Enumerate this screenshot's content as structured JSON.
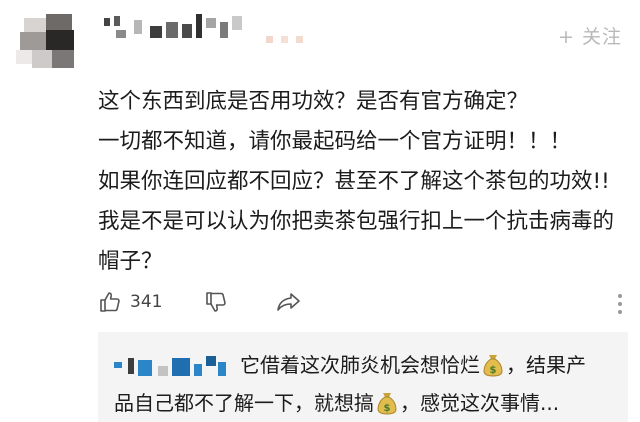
{
  "header": {
    "follow_label": "+ 关注"
  },
  "comment": {
    "lines": [
      "这个东西到底是否用功效？是否有官方确定？",
      "一切都不知道，请你最起码给一个官方证明！！！",
      "如果你连回应都不回应？甚至不了解这个茶包的功效!!",
      "我是不是可以认为你把卖茶包强行扣上一个抗击病毒的",
      "帽子？"
    ]
  },
  "actions": {
    "like_icon": "thumbs-up-icon",
    "like_count": "341",
    "dislike_icon": "thumbs-down-icon",
    "share_icon": "share-icon",
    "more_icon": "more-icon"
  },
  "reply": {
    "line1_text": "它借着这次肺炎机会想恰烂",
    "line1_suffix": "，结果产",
    "line2_text": "品自己都不了解一下，就想搞",
    "line2_suffix": "，感觉这次事情...",
    "emoji": "money-bag-icon"
  },
  "colors": {
    "text": "#1c1c1c",
    "muted": "#b9b9b9",
    "reply_bg": "#f4f4f4",
    "pixel_blue": "#2a86c9"
  }
}
